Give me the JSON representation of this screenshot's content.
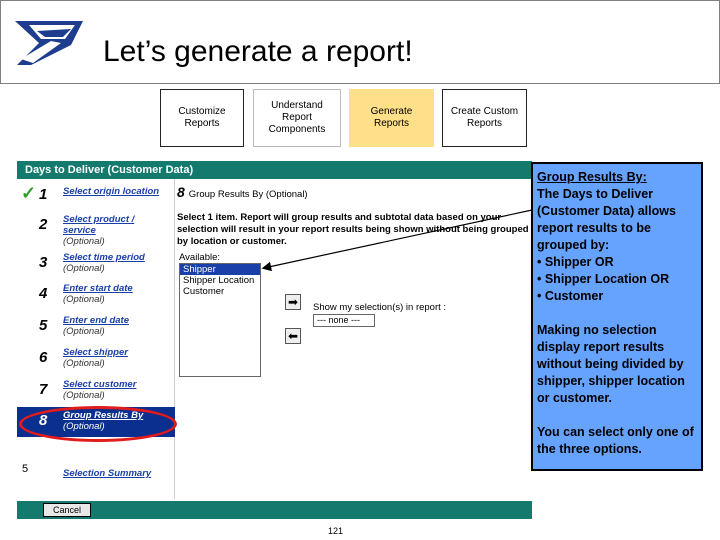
{
  "header": {
    "title": "Let’s generate a report!"
  },
  "steps": [
    {
      "label": "Customize Reports"
    },
    {
      "label": "Understand Report Components"
    },
    {
      "label": "Generate Reports"
    },
    {
      "label": "Create Custom Reports"
    }
  ],
  "app": {
    "panel_title": "Days to Deliver (Customer Data)",
    "nav": [
      {
        "num": "1",
        "label": "Select origin location",
        "optional": ""
      },
      {
        "num": "2",
        "label": "Select product / service",
        "optional": "(Optional)"
      },
      {
        "num": "3",
        "label": "Select time period",
        "optional": "(Optional)"
      },
      {
        "num": "4",
        "label": "Enter start date",
        "optional": "(Optional)"
      },
      {
        "num": "5",
        "label": "Enter end date",
        "optional": "(Optional)"
      },
      {
        "num": "6",
        "label": "Select shipper",
        "optional": "(Optional)"
      },
      {
        "num": "7",
        "label": "Select customer",
        "optional": "(Optional)"
      },
      {
        "num": "8",
        "label": "Group Results By",
        "optional": "(Optional)"
      }
    ],
    "summary_num": "5",
    "summary_label": "Selection Summary",
    "cancel_label": "Cancel",
    "main": {
      "step_num": "8",
      "step_title": "Group Results By (Optional)",
      "instruction": "Select 1 item. Report will group results and subtotal data based on your selection will result in your report results being shown without being grouped by location or customer.",
      "available_label": "Available:",
      "options": [
        "Shipper",
        "Shipper Location",
        "Customer"
      ],
      "selected_option": "Shipper",
      "add_arrow": "➡",
      "remove_arrow": "⬅",
      "show_label": "Show my selection(s) in report :",
      "show_value": "--- none ---"
    }
  },
  "callout": {
    "heading": "Group Results By:",
    "intro": "The Days to Deliver (Customer Data) allows report results to be grouped by:",
    "bullets": [
      "• Shipper OR",
      "• Shipper Location OR",
      "• Customer"
    ],
    "para2": "Making no selection display report results without being divided by shipper, shipper location or customer.",
    "para3": "You can select only one of the three options."
  },
  "page_number": "121",
  "colors": {
    "panel_teal": "#147a6e",
    "nav_active": "#0b2f8f",
    "callout_blue": "#66a3ff",
    "highlight_red": "#e21b1b",
    "generate_step": "#ffe08a"
  }
}
